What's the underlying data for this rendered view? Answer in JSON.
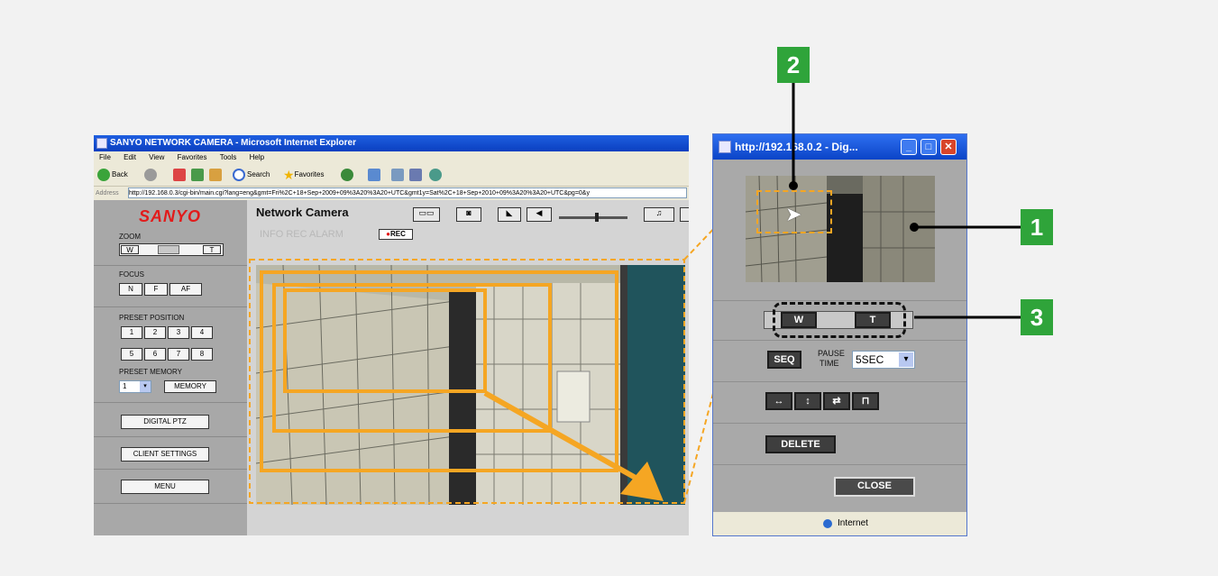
{
  "ie_window": {
    "title": "SANYO NETWORK CAMERA - Microsoft Internet Explorer",
    "menu": [
      "File",
      "Edit",
      "View",
      "Favorites",
      "Tools",
      "Help"
    ],
    "toolbar": {
      "back": "Back",
      "search": "Search",
      "favorites": "Favorites"
    },
    "address_label": "Address",
    "address_value": "http://192.168.0.3/cgi-bin/main.cgi?lang=eng&gmt=Fri%2C+18+Sep+2009+09%3A20%3A20+UTC&gmt1y=Sat%2C+18+Sep+2010+09%3A20%3A20+UTC&pg=0&y"
  },
  "sidebar": {
    "logo": "SANYO",
    "zoom_label": "ZOOM",
    "zoom_w": "W",
    "zoom_t": "T",
    "focus_label": "FOCUS",
    "focus_buttons": [
      "N",
      "F",
      "AF"
    ],
    "preset_position_label": "PRESET POSITION",
    "preset_buttons": [
      "1",
      "2",
      "3",
      "4",
      "5",
      "6",
      "7",
      "8"
    ],
    "preset_memory_label": "PRESET MEMORY",
    "preset_memory_value": "1",
    "memory_button": "MEMORY",
    "digital_ptz_button": "DIGITAL PTZ",
    "client_settings_button": "CLIENT SETTINGS",
    "menu_button": "MENU"
  },
  "content": {
    "title": "Network Camera",
    "status_text": "INFO REC ALARM",
    "rec_badge": "REC"
  },
  "popup": {
    "title": "http://192.168.0.2 - Dig...",
    "zoom_w": "W",
    "zoom_t": "T",
    "seq_button": "SEQ",
    "pause_label_1": "PAUSE",
    "pause_label_2": "TIME",
    "pause_value": "5SEC",
    "delete_button": "DELETE",
    "close_button": "CLOSE",
    "status_zone": "Internet"
  },
  "callouts": [
    "1",
    "2",
    "3"
  ],
  "colors": {
    "callout_green": "#2fa43a",
    "highlight_orange": "#f5a623",
    "rec_red": "#e21b1b"
  }
}
